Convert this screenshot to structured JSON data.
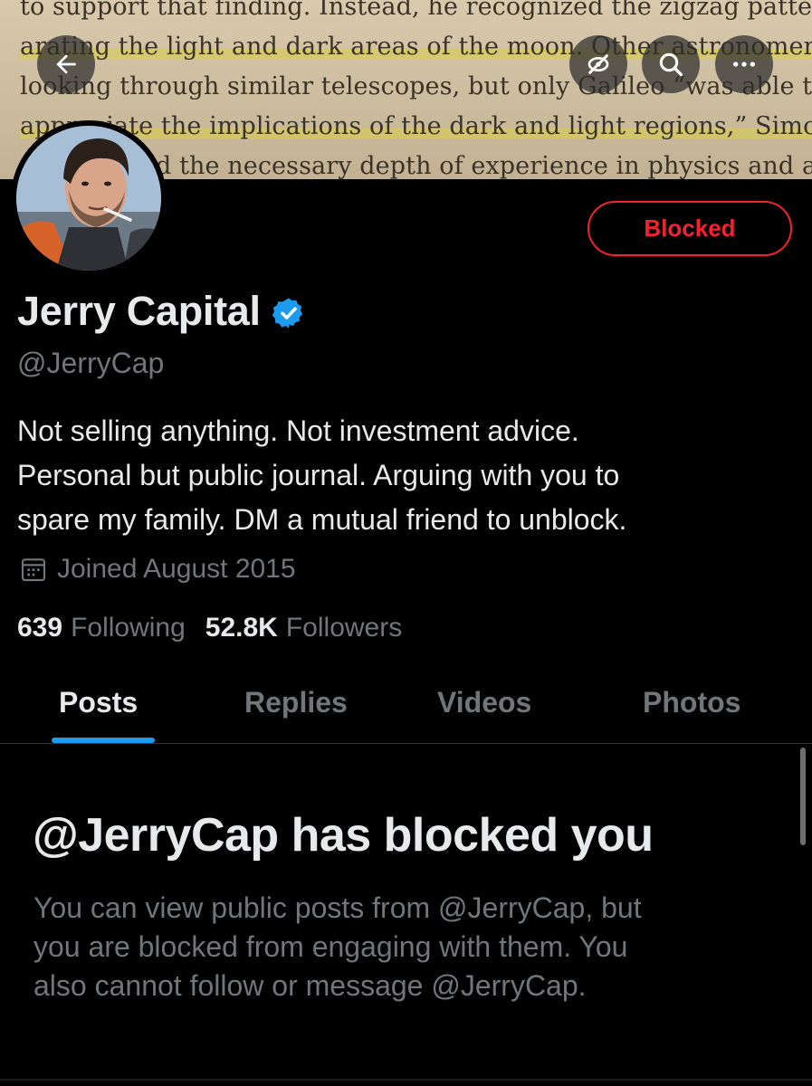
{
  "banner": {
    "lines": [
      "to support that finding. Instead, he recognized the zigzag pattern sep-",
      "arating the light and dark areas of the moon. Other astronomers were",
      "looking through similar telescopes, but only Galileo “was able to",
      "appreciate the implications of the dark and light regions,” Simonton",
      "d the necessary depth of experience in physics and astron-"
    ]
  },
  "top_bar": {
    "back_icon": "arrow-left-icon",
    "hide_icon": "eye-slash-icon",
    "search_icon": "search-icon",
    "more_icon": "more-horizontal-icon"
  },
  "profile": {
    "display_name": "Jerry Capital",
    "handle": "@JerryCap",
    "bio_lines": [
      "Not selling anything. Not investment advice.",
      "Personal but public journal. Arguing with you to",
      "spare my family. DM a mutual friend to unblock."
    ],
    "joined": "Joined August 2015",
    "following_count": "639",
    "following_label": "Following",
    "followers_count": "52.8K",
    "followers_label": "Followers",
    "blocked_button": "Blocked"
  },
  "tabs": [
    {
      "label": "Posts",
      "active": true
    },
    {
      "label": "Replies",
      "active": false
    },
    {
      "label": "Videos",
      "active": false
    },
    {
      "label": "Photos",
      "active": false
    }
  ],
  "blocked_notice": {
    "title": "@JerryCap has blocked you",
    "description_lines": [
      "You can view public posts from @JerryCap, but",
      "you are blocked from engaging with them. You",
      "also cannot follow or message @JerryCap."
    ]
  },
  "colors": {
    "background": "#000000",
    "text_primary": "#e7e9ea",
    "text_secondary": "#71767b",
    "accent_blue": "#1d9bf0",
    "blocked_red": "#f4212e"
  }
}
